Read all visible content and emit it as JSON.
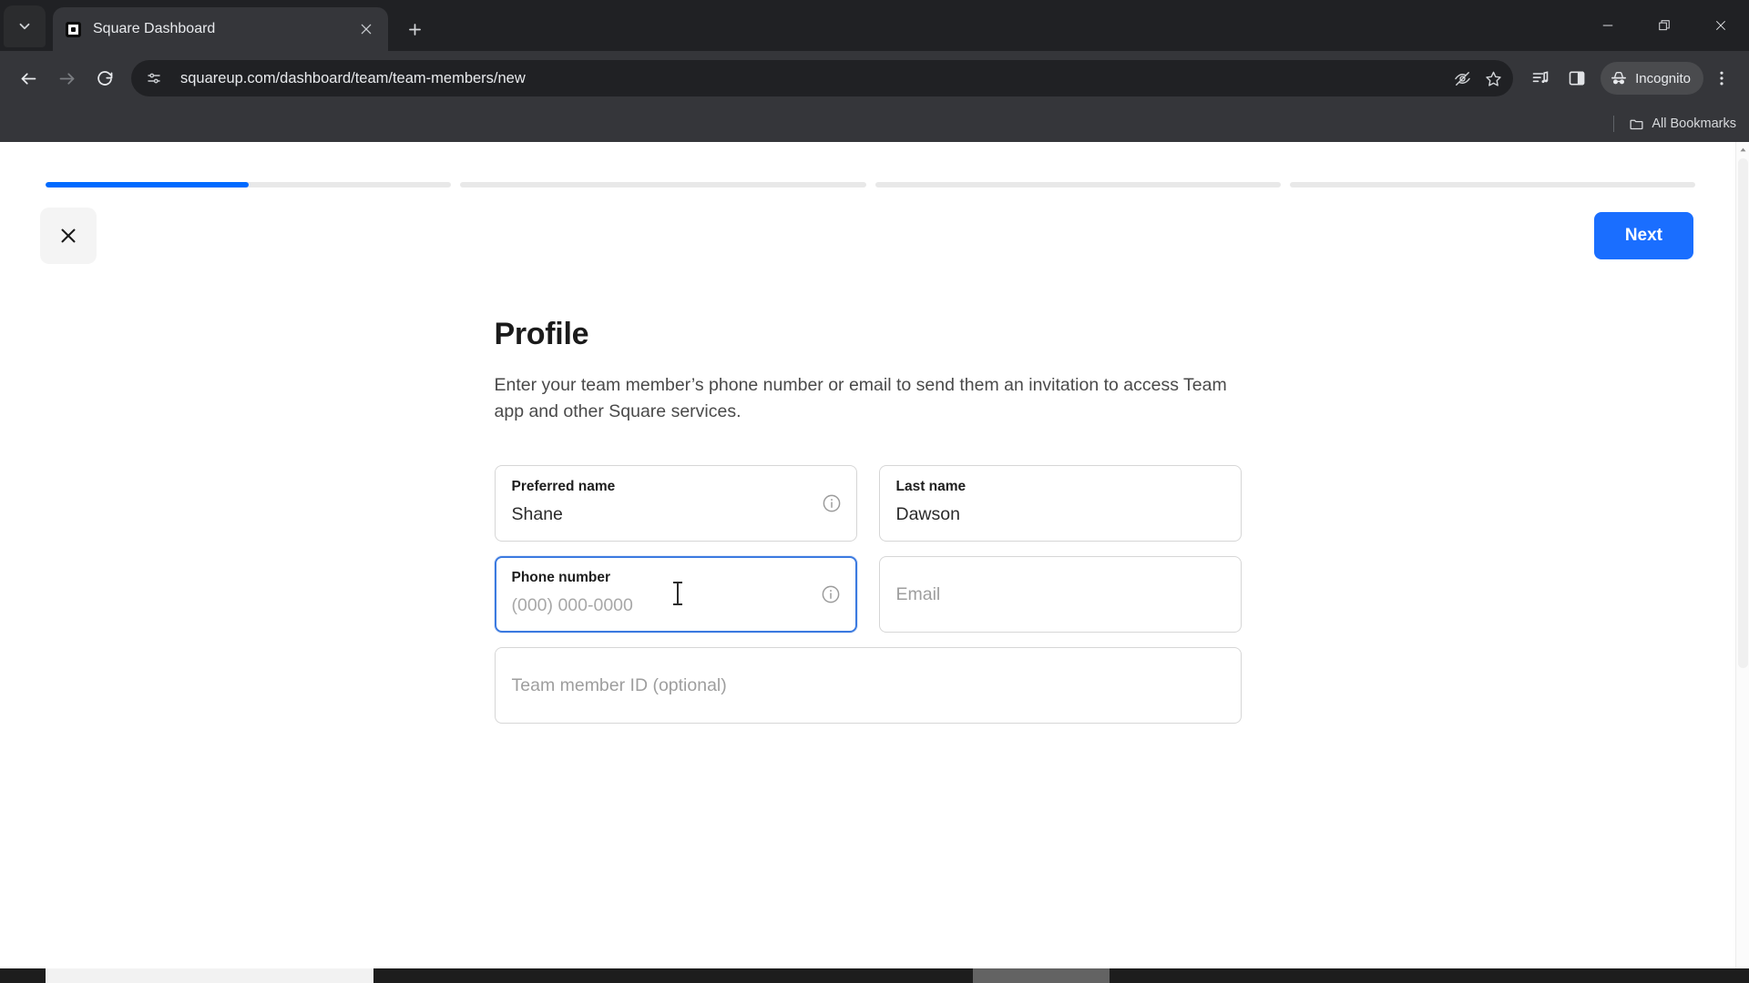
{
  "browser": {
    "tab": {
      "title": "Square Dashboard",
      "favicon_name": "square-favicon",
      "close_label": "Close tab"
    },
    "new_tab_label": "New Tab",
    "tab_search_label": "Search tabs",
    "window_controls": {
      "minimize": "Minimize",
      "maximize": "Restore",
      "close": "Close"
    },
    "nav": {
      "back": "Back",
      "forward": "Forward",
      "reload": "Reload"
    },
    "omnibox": {
      "url": "squareup.com/dashboard/team/team-members/new",
      "site_settings_label": "View site information",
      "tracking_protection_label": "Tracking protection",
      "bookmark_label": "Bookmark this tab"
    },
    "toolbar": {
      "reading_list_label": "Reading list",
      "side_panel_label": "Side panel",
      "incognito_label": "Incognito",
      "menu_label": "Customize and control Google Chrome"
    },
    "bookmarks": {
      "all_bookmarks_label": "All Bookmarks"
    }
  },
  "page": {
    "progress": {
      "segments": [
        50,
        0,
        0,
        0
      ],
      "accent_color": "#006aff",
      "track_color": "#e8e8e8"
    },
    "header": {
      "close_label": "Close",
      "next_label": "Next",
      "next_color": "#1a6eff"
    },
    "title": "Profile",
    "subtitle": "Enter your team member’s phone number or email to send them an invitation to access Team app and other Square services.",
    "fields": [
      {
        "name": "preferred-name",
        "label": "Preferred name",
        "value": "Shane",
        "placeholder": "",
        "has_info": true,
        "focused": false
      },
      {
        "name": "last-name",
        "label": "Last name",
        "value": "Dawson",
        "placeholder": "",
        "has_info": false,
        "focused": false
      },
      {
        "name": "phone-number",
        "label": "Phone number",
        "value": "",
        "placeholder": "(000) 000-0000",
        "has_info": true,
        "focused": true
      },
      {
        "name": "email",
        "label": "",
        "value": "",
        "placeholder": "Email",
        "has_info": false,
        "focused": false
      },
      {
        "name": "team-member-id",
        "label": "",
        "value": "",
        "placeholder": "Team member ID (optional)",
        "has_info": false,
        "focused": false
      }
    ]
  }
}
